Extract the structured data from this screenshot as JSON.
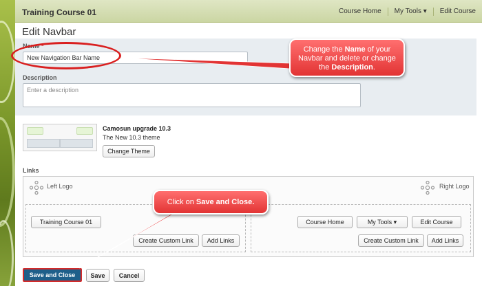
{
  "topbar": {
    "course": "Training Course 01",
    "menu": [
      "Course Home",
      "My Tools ▾",
      "Edit Course"
    ]
  },
  "page": {
    "title": "Edit Navbar"
  },
  "form": {
    "name_label": "Name",
    "name_required": "*",
    "name_value": "New Navigation Bar Name",
    "description_label": "Description",
    "description_placeholder": "Enter a description"
  },
  "theme": {
    "name": "Camosun upgrade 10.3",
    "subtitle": "The New 10.3 theme",
    "change_button": "Change Theme"
  },
  "links": {
    "label": "Links",
    "left_logo": "Left Logo",
    "right_logo": "Right Logo",
    "left_items": [
      "Training Course 01"
    ],
    "right_items": [
      "Course Home",
      "My Tools ▾",
      "Edit Course"
    ],
    "create_custom_link": "Create Custom Link",
    "add_links": "Add Links"
  },
  "actions": {
    "save_close": "Save and Close",
    "save": "Save",
    "cancel": "Cancel"
  },
  "callouts": {
    "name_pre": "Change the ",
    "name_bold1": "Name",
    "name_mid": " of your Navbar and delete or change the ",
    "name_bold2": "Description",
    "name_post": ".",
    "save_pre": "Click on ",
    "save_bold": "Save and Close."
  },
  "colors": {
    "topbar": "#cbd6a3",
    "accent_red": "#d91f1f",
    "primary_button": "#1e5f8a"
  }
}
